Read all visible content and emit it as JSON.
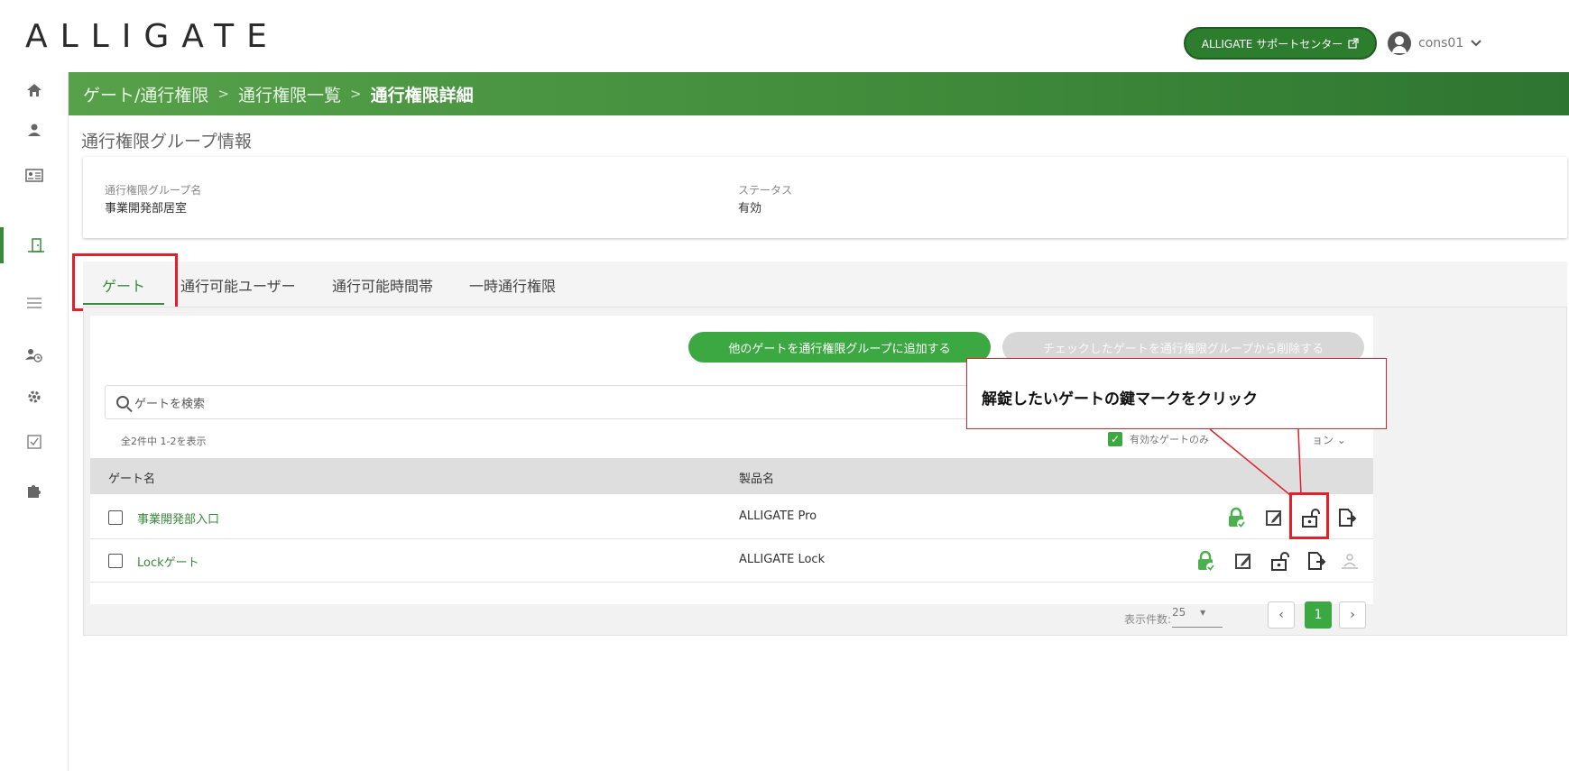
{
  "header": {
    "logo": "ALLIGATE",
    "support_label": "ALLIGATE サポートセンター",
    "username": "cons01"
  },
  "breadcrumb": {
    "item1": "ゲート/通行権限",
    "item2": "通行権限一覧",
    "current": "通行権限詳細",
    "separator": ">"
  },
  "section_title": "通行権限グループ情報",
  "info": {
    "group_name_label": "通行権限グループ名",
    "group_name_value": "事業開発部居室",
    "status_label": "ステータス",
    "status_value": "有効"
  },
  "tabs": [
    "ゲート",
    "通行可能ユーザー",
    "通行可能時間帯",
    "一時通行権限"
  ],
  "actions": {
    "add_label": "他のゲートを通行権限グループに追加する",
    "remove_label": "チェックしたゲートを通行権限グループから削除する"
  },
  "search": {
    "placeholder": "ゲートを検索"
  },
  "count_text": "全2件中 1-2を表示",
  "valid_filter_label": "有効なゲートのみ",
  "options_label": "ョン",
  "table": {
    "headers": [
      "ゲート名",
      "製品名"
    ],
    "rows": [
      {
        "name": "事業開発部入口",
        "product": "ALLIGATE Pro"
      },
      {
        "name": "Lockゲート",
        "product": "ALLIGATE Lock"
      }
    ]
  },
  "pager": {
    "label": "表示件数:",
    "per_page": "25",
    "current_page": "1"
  },
  "annotation": "解錠したいゲートの鍵マークをクリック",
  "colors": {
    "brand_green": "#3a8a3c",
    "accent_red": "#e2202a"
  }
}
